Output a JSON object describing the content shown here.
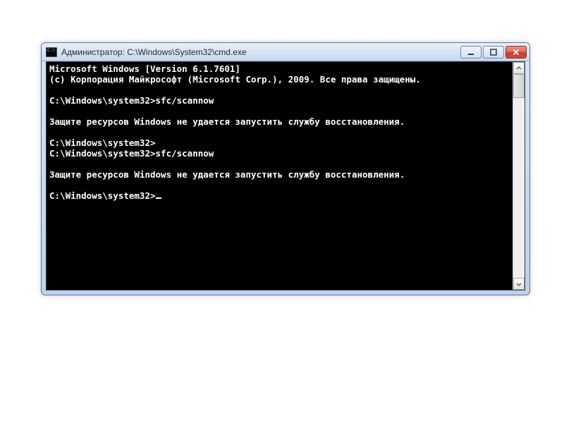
{
  "window": {
    "title": "Администратор: C:\\Windows\\System32\\cmd.exe"
  },
  "console": {
    "lines": [
      "Microsoft Windows [Version 6.1.7601]",
      "(c) Корпорация Майкрософт (Microsoft Corp.), 2009. Все права защищены.",
      "",
      "C:\\Windows\\system32>sfc/scannow",
      "",
      "Защите ресурсов Windows не удается запустить службу восстановления.",
      "",
      "C:\\Windows\\system32>",
      "C:\\Windows\\system32>sfc/scannow",
      "",
      "Защите ресурсов Windows не удается запустить службу восстановления.",
      "",
      "C:\\Windows\\system32>"
    ]
  }
}
